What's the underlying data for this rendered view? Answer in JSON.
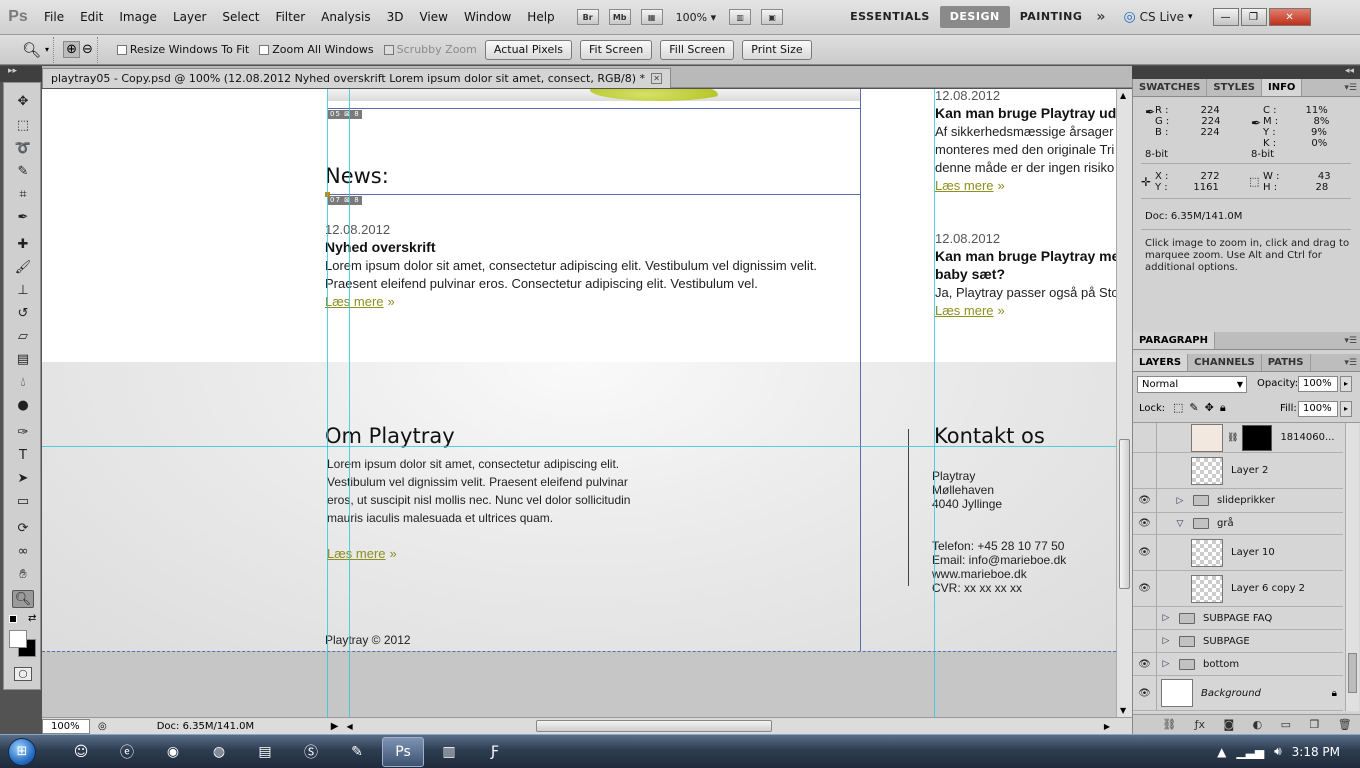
{
  "app": {
    "logo": "Ps",
    "menu": [
      "File",
      "Edit",
      "Image",
      "Layer",
      "Select",
      "Filter",
      "Analysis",
      "3D",
      "View",
      "Window",
      "Help"
    ],
    "app_bar_buttons": [
      "Br",
      "Mb"
    ],
    "zoom_level": "100%",
    "workspaces": [
      "ESSENTIALS",
      "DESIGN",
      "PAINTING"
    ],
    "active_workspace": "DESIGN",
    "cs_live": "CS Live"
  },
  "options_bar": {
    "resize_windows": "Resize Windows To Fit",
    "zoom_all": "Zoom All Windows",
    "scrubby_zoom": "Scrubby Zoom",
    "buttons": [
      "Actual Pixels",
      "Fit Screen",
      "Fill Screen",
      "Print Size"
    ]
  },
  "document": {
    "tab_title": "playtray05 - Copy.psd @ 100% (12.08.2012 Nyhed overskrift Lorem ipsum dolor sit amet, consect, RGB/8) *",
    "slice_label_1": "05",
    "slice_label_2": "07"
  },
  "website": {
    "news_heading": "News:",
    "news_date": "12.08.2012",
    "news_title": "Nyhed overskrift",
    "news_line1": "Lorem ipsum dolor sit amet, consectetur adipiscing elit. Vestibulum vel dignissim velit.",
    "news_line2": "Praesent eleifend pulvinar eros. Consectetur adipiscing elit. Vestibulum vel.",
    "read_more": "Læs mere",
    "read_more_arrow": "»",
    "faq1_date": "12.08.2012",
    "faq1_title": "Kan man bruge Playtray ud",
    "faq1_line1": "Af sikkerhedsmæssige årsager",
    "faq1_line2": "monteres med den originale Tri",
    "faq1_line3": "denne måde er der ingen risiko",
    "faq2_date": "12.08.2012",
    "faq2_title1": "Kan man bruge Playtray me",
    "faq2_title2": "baby sæt?",
    "faq2_line1": "Ja, Playtray passer også på Sto",
    "about_heading": "Om Playtray",
    "about_line1": "Lorem ipsum dolor sit amet, consectetur adipiscing elit.",
    "about_line2": "Vestibulum vel dignissim velit. Praesent eleifend pulvinar",
    "about_line3": "eros, ut suscipit nisl mollis nec. Nunc vel dolor sollicitudin",
    "about_line4": "mauris iaculis malesuada et ultrices quam.",
    "contact_heading": "Kontakt os",
    "contact_name": "Playtray",
    "contact_street": "Møllehaven",
    "contact_city": "4040 Jyllinge",
    "contact_phone": "Telefon: +45 28 10 77 50",
    "contact_email": "Email: info@marieboe.dk",
    "contact_web": "www.marieboe.dk",
    "contact_cvr": "CVR: xx xx xx xx",
    "footer": "Playtray © 2012"
  },
  "status_bar": {
    "zoom": "100%",
    "doc_size": "Doc: 6.35M/141.0M"
  },
  "info_panel": {
    "tabs": [
      "SWATCHES",
      "STYLES",
      "INFO"
    ],
    "active_tab": "INFO",
    "r_label": "R :",
    "r_value": "224",
    "g_label": "G :",
    "g_value": "224",
    "b_label": "B :",
    "b_value": "224",
    "bit_left": "8-bit",
    "c_label": "C :",
    "c_value": "11%",
    "m_label": "M :",
    "m_value": "8%",
    "y_label": "Y :",
    "y_value": "9%",
    "k_label": "K :",
    "k_value": "0%",
    "bit_right": "8-bit",
    "x_label": "X :",
    "x_value": "272",
    "y2_label": "Y :",
    "y2_value": "1161",
    "w_label": "W :",
    "w_value": "43",
    "h_label": "H :",
    "h_value": "28",
    "doc": "Doc: 6.35M/141.0M",
    "hint": "Click image to zoom in, click and drag to marquee zoom.  Use Alt and Ctrl for additional options."
  },
  "paragraph_panel": {
    "title": "PARAGRAPH"
  },
  "layers_panel": {
    "tabs": [
      "LAYERS",
      "CHANNELS",
      "PATHS"
    ],
    "active_tab": "LAYERS",
    "blend_mode": "Normal",
    "opacity_label": "Opacity:",
    "opacity_value": "100%",
    "lock_label": "Lock:",
    "fill_label": "Fill:",
    "fill_value": "100%",
    "layers": [
      {
        "name": "1814060...",
        "visible": false
      },
      {
        "name": "Layer 2",
        "visible": false
      },
      {
        "name": "slideprikker",
        "visible": true
      },
      {
        "name": "grå",
        "visible": true
      },
      {
        "name": "Layer 10",
        "visible": true
      },
      {
        "name": "Layer 6 copy 2",
        "visible": true
      },
      {
        "name": "SUBPAGE FAQ",
        "visible": false
      },
      {
        "name": "SUBPAGE",
        "visible": false
      },
      {
        "name": "bottom",
        "visible": true
      },
      {
        "name": "Background",
        "visible": true
      }
    ]
  },
  "taskbar": {
    "clock": "3:18 PM"
  },
  "colors": {
    "link": "#8d8f1e",
    "guide": "#27c8d8",
    "active_workspace_bg": "#8a8a8a"
  }
}
